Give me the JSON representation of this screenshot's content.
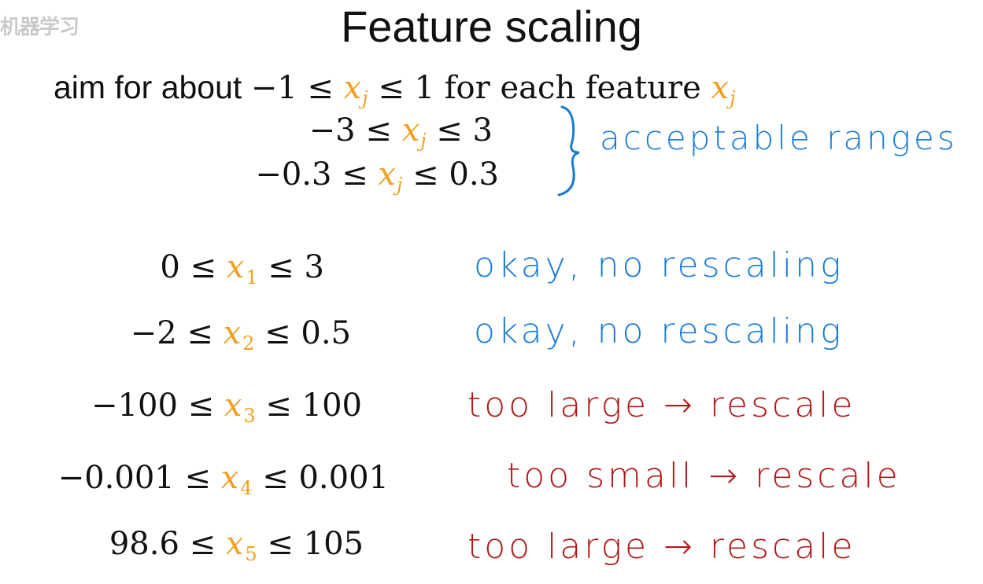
{
  "watermark": "机器学习 ",
  "title": "Feature scaling",
  "aim": {
    "lead": "aim for about ",
    "ineq_left": "−1 ≤ ",
    "var": "x",
    "var_sub": "j",
    "ineq_right": " ≤ 1 for each feature ",
    "var2": "x",
    "var2_sub": "j"
  },
  "acceptable": [
    {
      "left": "−3 ≤ ",
      "var": "x",
      "sub": "j",
      "right": " ≤ 3"
    },
    {
      "left": "−0.3 ≤ ",
      "var": "x",
      "sub": "j",
      "right": " ≤ 0.3"
    }
  ],
  "acceptable_note": "acceptable ranges",
  "features": [
    {
      "left": "0 ≤ ",
      "var": "x",
      "sub": "1",
      "right": " ≤ 3",
      "note": "okay, no rescaling",
      "note_color": "#1a7ad6"
    },
    {
      "left": "−2 ≤ ",
      "var": "x",
      "sub": "2",
      "right": " ≤ 0.5",
      "note": "okay, no rescaling",
      "note_color": "#1a7ad6"
    },
    {
      "left": "−100 ≤ ",
      "var": "x",
      "sub": "3",
      "right": " ≤ 100",
      "note": "too large → rescale",
      "note_color": "#b01818"
    },
    {
      "left": "−0.001 ≤ ",
      "var": "x",
      "sub": "4",
      "right": " ≤ 0.001",
      "note": "too small → rescale",
      "note_color": "#b01818"
    },
    {
      "left": "98.6 ≤ ",
      "var": "x",
      "sub": "5",
      "right": " ≤ 105",
      "note": "too large → rescale",
      "note_color": "#b01818"
    }
  ],
  "colors": {
    "variable": "#f0a020",
    "okay_note": "#1a7ad6",
    "rescale_note": "#b01818",
    "text": "#111111"
  }
}
